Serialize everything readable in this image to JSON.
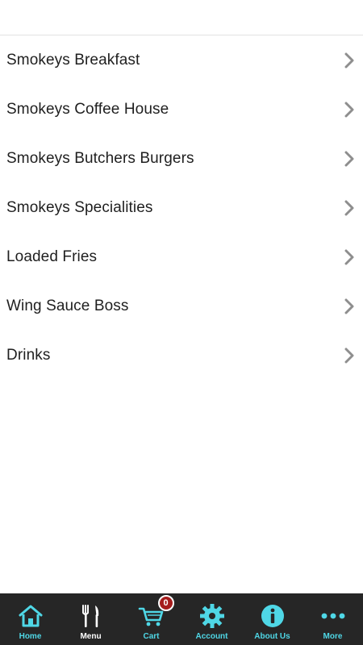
{
  "menu": {
    "items": [
      {
        "label": "Smokeys Breakfast"
      },
      {
        "label": "Smokeys Coffee House"
      },
      {
        "label": "Smokeys Butchers Burgers"
      },
      {
        "label": "Smokeys Specialities"
      },
      {
        "label": "Loaded Fries"
      },
      {
        "label": "Wing Sauce Boss"
      },
      {
        "label": "Drinks"
      }
    ]
  },
  "tabbar": {
    "home": "Home",
    "menu": "Menu",
    "cart": "Cart",
    "cart_count": "0",
    "account": "Account",
    "about": "About Us",
    "more": "More"
  },
  "colors": {
    "accent": "#4fd7e6",
    "tabbar_bg": "#262626",
    "badge": "#a51c1c",
    "chevron": "#8e8e8e"
  }
}
